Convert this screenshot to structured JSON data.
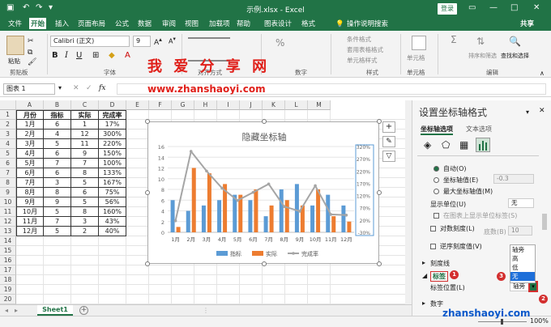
{
  "window": {
    "title": "示例.xlsx  -  Excel",
    "login": "登录",
    "share": "共享"
  },
  "tabs": [
    "文件",
    "开始",
    "插入",
    "页面布局",
    "公式",
    "数据",
    "审阅",
    "视图",
    "加载项",
    "帮助",
    "图表设计",
    "格式"
  ],
  "tell_me": "操作说明搜索",
  "ribbon": {
    "clipboard": "剪贴板",
    "paste": "粘贴",
    "font_group": "字体",
    "font_name": "Calibri (正文)",
    "font_size": "9",
    "align_group": "对齐方式",
    "number_group": "数字",
    "styles_group": "样式",
    "cells_group": "单元格",
    "editing_group": "编辑",
    "cond_format": "条件格式",
    "table_format": "套用表格格式",
    "cell_style": "单元格样式",
    "cell_btn": "单元格",
    "sort": "排序和筛选",
    "find": "查找和选择"
  },
  "watermark": {
    "line1": "我 爱 分 享 网",
    "line2": "www.zhanshaoyi.com",
    "corner": "zhanshaoyi.com"
  },
  "formula": {
    "namebox": "图表 1",
    "fx": "fx"
  },
  "columns": [
    "A",
    "B",
    "C",
    "D",
    "E",
    "F",
    "G",
    "H",
    "I",
    "J",
    "K",
    "L",
    "M"
  ],
  "rows": [
    "1",
    "2",
    "3",
    "4",
    "5",
    "6",
    "7",
    "8",
    "9",
    "10",
    "11",
    "12",
    "13",
    "14",
    "15",
    "16",
    "17",
    "18",
    "19",
    "20",
    "21"
  ],
  "table": {
    "header": [
      "月份",
      "指标",
      "实际",
      "完成率"
    ],
    "rows": [
      [
        "1月",
        "6",
        "1",
        "17%"
      ],
      [
        "2月",
        "4",
        "12",
        "300%"
      ],
      [
        "3月",
        "5",
        "11",
        "220%"
      ],
      [
        "4月",
        "6",
        "9",
        "150%"
      ],
      [
        "5月",
        "7",
        "7",
        "100%"
      ],
      [
        "6月",
        "6",
        "8",
        "133%"
      ],
      [
        "7月",
        "3",
        "5",
        "167%"
      ],
      [
        "8月",
        "8",
        "6",
        "75%"
      ],
      [
        "9月",
        "9",
        "5",
        "56%"
      ],
      [
        "10月",
        "5",
        "8",
        "160%"
      ],
      [
        "11月",
        "7",
        "3",
        "43%"
      ],
      [
        "12月",
        "5",
        "2",
        "40%"
      ]
    ]
  },
  "chart_data": {
    "type": "bar",
    "title": "隐藏坐标轴",
    "categories": [
      "1月",
      "2月",
      "3月",
      "4月",
      "5月",
      "6月",
      "7月",
      "8月",
      "9月",
      "10月",
      "11月",
      "12月"
    ],
    "series": [
      {
        "name": "指标",
        "type": "bar",
        "color": "#5b9bd5",
        "values": [
          6,
          4,
          5,
          6,
          7,
          6,
          3,
          8,
          9,
          5,
          7,
          5
        ]
      },
      {
        "name": "实际",
        "type": "bar",
        "color": "#ed7d31",
        "values": [
          1,
          12,
          11,
          9,
          7,
          8,
          5,
          6,
          5,
          8,
          3,
          2
        ]
      },
      {
        "name": "完成率",
        "type": "line",
        "axis": "secondary",
        "color": "#a5a5a5",
        "values": [
          17,
          300,
          220,
          150,
          100,
          133,
          167,
          75,
          56,
          160,
          43,
          40
        ]
      }
    ],
    "y_ticks": [
      "16",
      "14",
      "12",
      "10",
      "8",
      "6",
      "4",
      "2",
      "0"
    ],
    "y2_ticks": [
      "320%",
      "270%",
      "220%",
      "170%",
      "120%",
      "70%",
      "20%",
      "-30%"
    ],
    "ylim": [
      0,
      16
    ],
    "y2lim": [
      -30,
      320
    ]
  },
  "panel": {
    "title": "设置坐标轴格式",
    "tab1": "坐标轴选项",
    "tab2": "文本选项",
    "auto": "自动(O)",
    "axis_value": "坐标轴值(E)",
    "axis_value_input": "-0.3",
    "max_axis": "最大坐标轴值(M)",
    "display_unit": "显示单位(U)",
    "display_unit_value": "无",
    "show_unit": "在图表上显示单位标签(S)",
    "log": "对数刻度(L)",
    "base": "底数(B)",
    "base_value": "10",
    "reverse": "逆序刻度值(V)",
    "ticks": "刻度线",
    "labels": "标签",
    "label_pos": "标签位置(L)",
    "label_pos_value": "轴旁",
    "number": "数字",
    "dropdown": [
      "轴旁",
      "高",
      "低",
      "无"
    ]
  },
  "badges": [
    "1",
    "2",
    "3"
  ],
  "sheet": {
    "name": "Sheet1",
    "add": "+"
  },
  "status": {
    "zoom": "100%"
  }
}
